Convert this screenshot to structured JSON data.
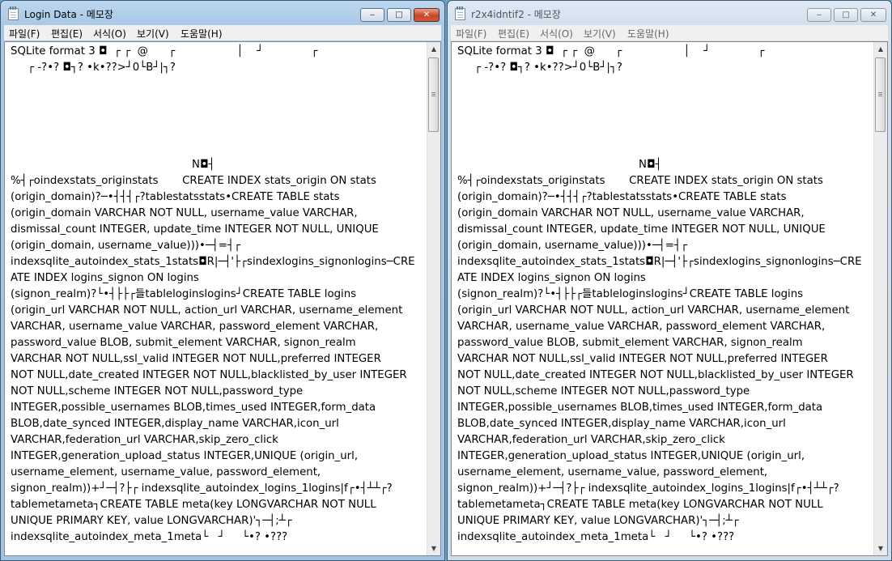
{
  "windows": [
    {
      "title": "Login Data - 메모장",
      "active": true,
      "controls": {
        "minimize": "‒",
        "maximize": "□",
        "close": "✕"
      },
      "menu": [
        "파일(F)",
        "편집(E)",
        "서식(O)",
        "보기(V)",
        "도움말(H)"
      ],
      "lines": [
        "SQLite format 3 ◘  ┌ ┌  @      ┌                  │    ┘              ┌",
        "     ┌ -?•? ◘┐? •k•??>┘0└B┘|┐?",
        "",
        "",
        "",
        "",
        "",
        "                                                     N◘┤",
        "%┤┌oindexstats_originstats       CREATE INDEX stats_origin ON stats",
        "(origin_domain)?─•┤┤┤┌?tablestatsstats•CREATE TABLE stats",
        "(origin_domain VARCHAR NOT NULL, username_value VARCHAR,",
        "dismissal_count INTEGER, update_time INTEGER NOT NULL, UNIQUE",
        "(origin_domain, username_value)))•─┤=┤┌",
        "indexsqlite_autoindex_stats_1stats◘R|─┤'├┌sindexlogins_signonlogins─CRE",
        "ATE INDEX logins_signon ON logins",
        "(signon_realm)?└•┤├├┌들tableloginslogins┘CREATE TABLE logins",
        "(origin_url VARCHAR NOT NULL, action_url VARCHAR, username_element",
        "VARCHAR, username_value VARCHAR, password_element VARCHAR,",
        "password_value BLOB, submit_element VARCHAR, signon_realm",
        "VARCHAR NOT NULL,ssl_valid INTEGER NOT NULL,preferred INTEGER",
        "NOT NULL,date_created INTEGER NOT NULL,blacklisted_by_user INTEGER",
        "NOT NULL,scheme INTEGER NOT NULL,password_type",
        "INTEGER,possible_usernames BLOB,times_used INTEGER,form_data",
        "BLOB,date_synced INTEGER,display_name VARCHAR,icon_url",
        "VARCHAR,federation_url VARCHAR,skip_zero_click",
        "INTEGER,generation_upload_status INTEGER,UNIQUE (origin_url,",
        "username_element, username_value, password_element,",
        "signon_realm))+┘─┤?├┌ indexsqlite_autoindex_logins_1logins|f┌•┤┴┴┌?",
        "tablemetameta┐CREATE TABLE meta(key LONGVARCHAR NOT NULL",
        "UNIQUE PRIMARY KEY, value LONGVARCHAR)'┐─┤;┴┌",
        "indexsqlite_autoindex_meta_1meta└   ┘     └•? •???"
      ]
    },
    {
      "title": "r2x4idntif2 - 메모장",
      "active": false,
      "controls": {
        "minimize": "‒",
        "maximize": "□",
        "close": "✕"
      },
      "menu": [
        "파일(F)",
        "편집(E)",
        "서식(O)",
        "보기(V)",
        "도움말(H)"
      ],
      "lines": [
        "SQLite format 3 ◘  ┌ ┌  @      ┌                  │    ┘              ┌",
        "     ┌ -?•? ◘┐? •k•??>┘0└B┘|┐?",
        "",
        "",
        "",
        "",
        "",
        "                                                     N◘┤",
        "%┤┌oindexstats_originstats       CREATE INDEX stats_origin ON stats",
        "(origin_domain)?─•┤┤┤┌?tablestatsstats•CREATE TABLE stats",
        "(origin_domain VARCHAR NOT NULL, username_value VARCHAR,",
        "dismissal_count INTEGER, update_time INTEGER NOT NULL, UNIQUE",
        "(origin_domain, username_value)))•─┤=┤┌",
        "indexsqlite_autoindex_stats_1stats◘R|─┤'├┌sindexlogins_signonlogins─CRE",
        "ATE INDEX logins_signon ON logins",
        "(signon_realm)?└•┤├├┌들tableloginslogins┘CREATE TABLE logins",
        "(origin_url VARCHAR NOT NULL, action_url VARCHAR, username_element",
        "VARCHAR, username_value VARCHAR, password_element VARCHAR,",
        "password_value BLOB, submit_element VARCHAR, signon_realm",
        "VARCHAR NOT NULL,ssl_valid INTEGER NOT NULL,preferred INTEGER",
        "NOT NULL,date_created INTEGER NOT NULL,blacklisted_by_user INTEGER",
        "NOT NULL,scheme INTEGER NOT NULL,password_type",
        "INTEGER,possible_usernames BLOB,times_used INTEGER,form_data",
        "BLOB,date_synced INTEGER,display_name VARCHAR,icon_url",
        "VARCHAR,federation_url VARCHAR,skip_zero_click",
        "INTEGER,generation_upload_status INTEGER,UNIQUE (origin_url,",
        "username_element, username_value, password_element,",
        "signon_realm))+┘─┤?├┌ indexsqlite_autoindex_logins_1logins|f┌•┤┴┴┌?",
        "tablemetameta┐CREATE TABLE meta(key LONGVARCHAR NOT NULL",
        "UNIQUE PRIMARY KEY, value LONGVARCHAR)'┐─┤;┴┌",
        "indexsqlite_autoindex_meta_1meta└   ┘     └•? •???"
      ]
    }
  ],
  "icons": {
    "app": "notepad-icon",
    "scroll_up": "▲",
    "scroll_down": "▼"
  },
  "colors": {
    "desktop": "#6fa3c6",
    "close_button": "#c8452a"
  }
}
